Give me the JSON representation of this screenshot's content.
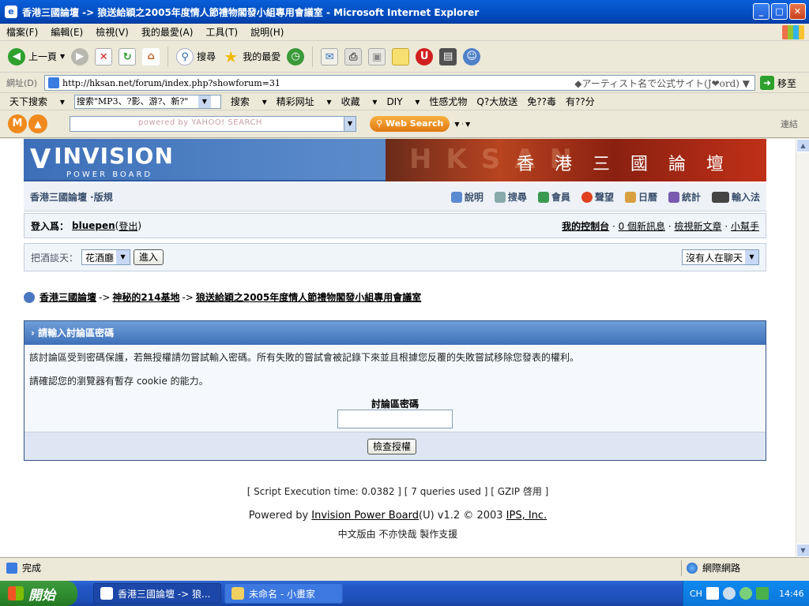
{
  "window": {
    "title": "香港三國論壇 -> 狼送給穎之2005年度情人節禮物閣發小組專用會議室 - Microsoft Internet Explorer"
  },
  "menu": [
    "檔案(F)",
    "編輯(E)",
    "檢視(V)",
    "我的最愛(A)",
    "工具(T)",
    "說明(H)"
  ],
  "toolbar": {
    "back": "上一頁",
    "search": "搜尋",
    "favorites": "我的最愛"
  },
  "address": {
    "label": "網址(D)",
    "url": "http://hksan.net/forum/index.php?showforum=31",
    "hint": "アーティスト名で公式サイト(J❤ord)",
    "go": "移至"
  },
  "links": {
    "items": [
      "天下搜索",
      "搜索\"MP3、?影、游?、新?\"",
      "搜索",
      "精彩网址",
      "收藏",
      "DIY",
      "性感尤物",
      "Q?大放送",
      "免??毒",
      "有??分"
    ]
  },
  "yahoo": {
    "logo": "M",
    "placeholder": "powered by YAHOO! SEARCH",
    "button": "Web Search",
    "connect": "連結"
  },
  "forum": {
    "logo_main": "INVISION",
    "logo_sub": "POWER BOARD",
    "banner_title": "香港三國論壇",
    "banner_letters": "HKSAN",
    "nav_left": "香港三國論壇 ·版規",
    "nav_items": [
      "說明",
      "搜尋",
      "會員",
      "聲望",
      "日曆",
      "統計",
      "輸入法"
    ],
    "login_label": "登入爲：",
    "username": "bluepen",
    "logout_pre": " (",
    "logout": "登出",
    "logout_post": ")",
    "control_panel": "我的控制台",
    "new_msgs": "0 個新訊息",
    "new_posts": "檢視新文章",
    "helper": "小幫手",
    "chat_label": "把酒談天：",
    "chat_select": "花酒廳",
    "chat_go": "進入",
    "chat_status": "沒有人在聊天",
    "breadcrumb": [
      "香港三國論壇",
      "神秘的214基地",
      "狼送給穎之2005年度情人節禮物閣發小組專用會議室"
    ],
    "breadcrumb_sep": "->",
    "panel_title": "› 請輸入討論區密碼",
    "panel_text1": "該討論區受到密碼保護，若無授權請勿嘗試輸入密碼。所有失敗的嘗試會被記錄下來並且根據您反覆的失敗嘗試移除您發表的權利。",
    "panel_text2": "請確認您的瀏覽器有暫存 cookie 的能力。",
    "pw_label": "討論區密碼",
    "submit": "檢查授權"
  },
  "footer": {
    "stats": "[ Script Execution time: 0.0382 ]   [ 7 queries used ]   [ GZIP 啓用 ]",
    "powered_pre": "Powered by ",
    "powered_link": "Invision Power Board",
    "powered_post": "(U) v1.2 © 2003  ",
    "ips": "IPS, Inc.",
    "chinese": "中文版由 不亦快哉 製作支援"
  },
  "status": {
    "left": "完成",
    "zone": "網際網路"
  },
  "taskbar": {
    "start": "開始",
    "tasks": [
      "香港三國論壇 -> 狼...",
      "未命名 - 小畫家"
    ],
    "ime": "CH",
    "time": "14:46"
  }
}
